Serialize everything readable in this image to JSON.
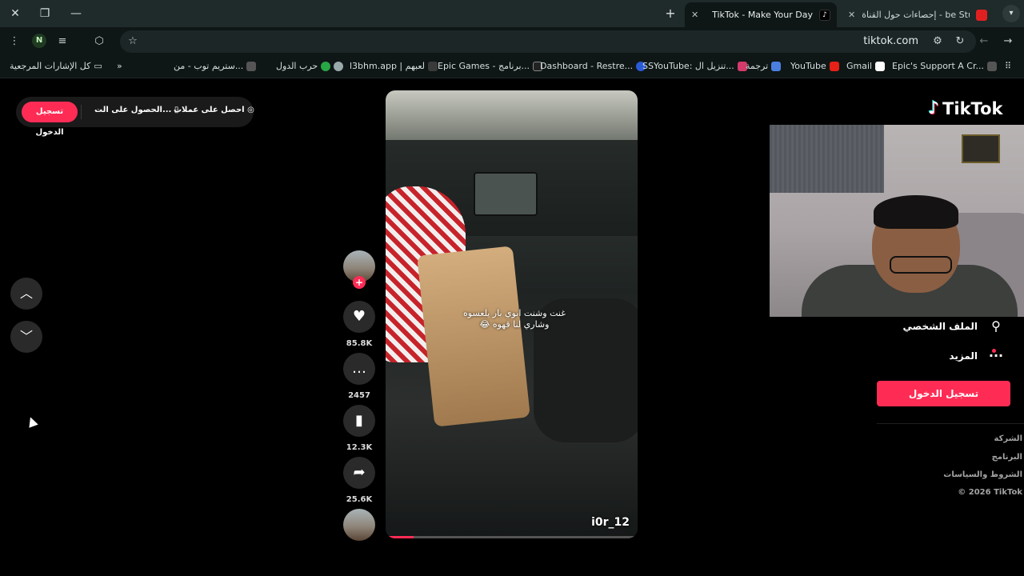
{
  "browser": {
    "tabs": [
      {
        "title": "TikTok - Make Your Day",
        "active": true
      },
      {
        "title": "إحصاءات حول القناة - be Studio",
        "active": false
      }
    ],
    "url": "tiktok.com",
    "profile_initial": "N",
    "bookmarks": [
      "كل الإشارات المرجعية",
      "ستريم توب - من...",
      "حرب الدول",
      "l3bhm.app | لعبهم",
      "Epic Games - برنامج...",
      "Dashboard - Restre...",
      "SSYouTube: تنزيل ال...",
      "ترجمة",
      "YouTube",
      "Gmail",
      "Epic's Support A Cr..."
    ],
    "icons": [
      "close-icon",
      "restore-icon",
      "minimize-icon",
      "new-tab-icon",
      "tab-search-icon",
      "forward-icon",
      "back-icon",
      "reload-icon",
      "site-settings-icon",
      "star-icon",
      "extensions-icon",
      "media-icon",
      "menu-icon",
      "apps-icon",
      "chevron-double-icon"
    ]
  },
  "tiktok": {
    "top_bar": {
      "signup_label": "تسجيل الدخول",
      "get_app_label": "الحصول على الت...",
      "coins_label": "احصل على عملات"
    },
    "video": {
      "caption": "غنت وشنت ابوي بار يلعسوه وشاري لنا قهوه 😂",
      "username": "i0r_12",
      "progress": 0.11
    },
    "actions": {
      "likes": "85.8K",
      "comments": "2457",
      "saves": "12.3K",
      "shares": "25.6K"
    },
    "sidebar": {
      "logo_text": "TikTok",
      "profile_label": "الملف الشخصي",
      "more_label": "المزيد",
      "login_label": "تسجيل الدخول",
      "footer_links": [
        "الشركة",
        "البرنامج",
        "الشروط والسياسات",
        "© 2026 TikTok"
      ]
    }
  }
}
